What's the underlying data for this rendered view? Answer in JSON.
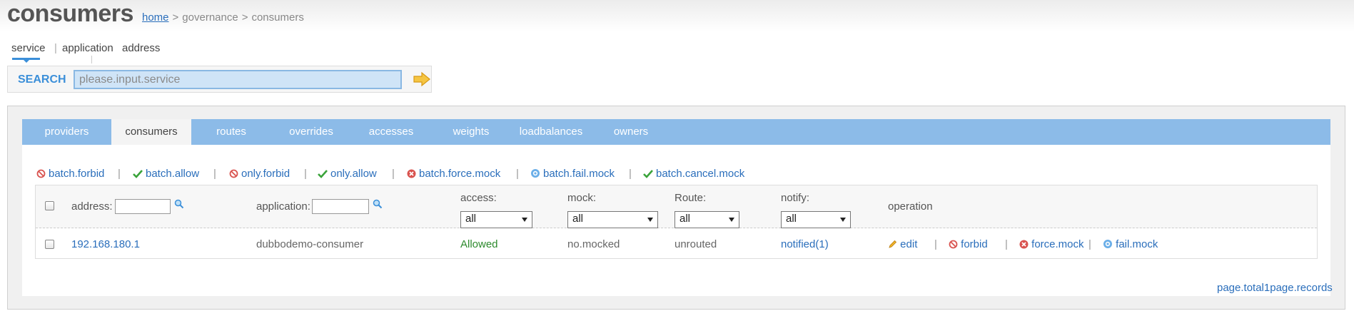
{
  "header": {
    "title": "consumers",
    "breadcrumb": {
      "home": "home",
      "sep": ">",
      "level1": "governance",
      "level2": "consumers"
    }
  },
  "search_tabs": {
    "service": "service",
    "divider": "|",
    "application": "application",
    "address": "address"
  },
  "search": {
    "label": "SEARCH",
    "placeholder": "please.input.service",
    "go_icon": "arrow-right-icon"
  },
  "nav": [
    {
      "label": "providers"
    },
    {
      "label": "consumers",
      "active": true
    },
    {
      "label": "routes"
    },
    {
      "label": "overrides"
    },
    {
      "label": "accesses"
    },
    {
      "label": "weights"
    },
    {
      "label": "loadbalances"
    },
    {
      "label": "owners"
    }
  ],
  "batch_actions": {
    "pipe": "|",
    "forbid": {
      "label": "batch.forbid",
      "icon": "forbid-icon"
    },
    "allow": {
      "label": "batch.allow",
      "icon": "check-icon"
    },
    "only_forbid": {
      "label": "only.forbid",
      "icon": "forbid-icon"
    },
    "only_allow": {
      "label": "only.allow",
      "icon": "check-icon"
    },
    "force_mock": {
      "label": "batch.force.mock",
      "icon": "x-circle-icon"
    },
    "fail_mock": {
      "label": "batch.fail.mock",
      "icon": "gear-icon"
    },
    "cancel_mock": {
      "label": "batch.cancel.mock",
      "icon": "check-icon"
    }
  },
  "table": {
    "headers": {
      "address": "address:",
      "application": "application:",
      "access": "access:",
      "mock": "mock:",
      "route": "Route:",
      "notify": "notify:",
      "operation": "operation"
    },
    "filters": {
      "access": "all",
      "mock": "all",
      "route": "all",
      "notify": "all"
    },
    "rows": [
      {
        "address": "192.168.180.1",
        "application": "dubbodemo-consumer",
        "access": "Allowed",
        "mock": "no.mocked",
        "route": "unrouted",
        "notify": "notified(1)"
      }
    ],
    "row_ops": {
      "edit": "edit",
      "forbid": "forbid",
      "force_mock": "force.mock",
      "fail_mock": "fail.mock",
      "pipe": "|"
    }
  },
  "footer": {
    "page_records": "page.total1page.records"
  },
  "colors": {
    "accent": "#3b8fd9",
    "nav_bg": "#8cbbe8",
    "link": "#2a6ebb",
    "allowed": "#2d8a2d",
    "forbid": "#d9534f"
  }
}
